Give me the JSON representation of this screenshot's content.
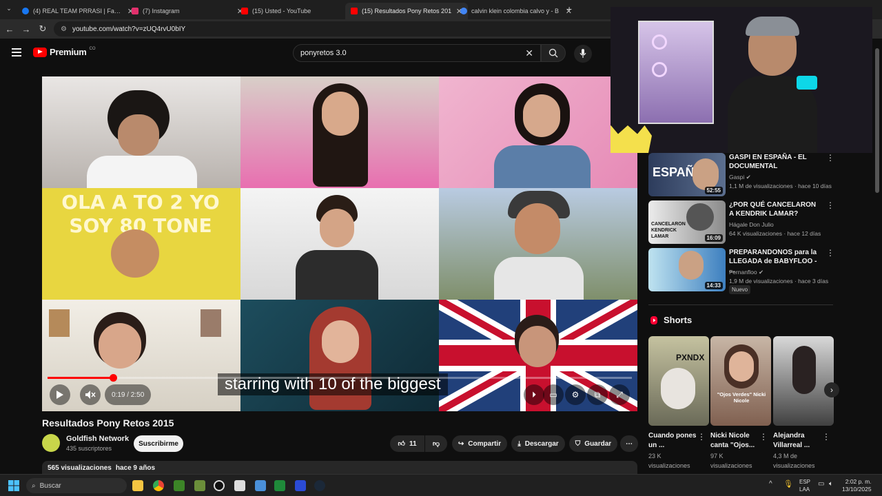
{
  "browser": {
    "tabs": [
      {
        "label": "(4) REAL TEAM PRRASI | Facebo",
        "favicon_color": "#1877f2",
        "favicon": "facebook-icon"
      },
      {
        "label": "(7) Instagram",
        "favicon_color": "#e1306c",
        "favicon": "instagram-icon"
      },
      {
        "label": "(15) Usted - YouTube",
        "favicon_color": "#ff0000",
        "favicon": "youtube-icon"
      },
      {
        "label": "(15) Resultados Pony Retos 201",
        "favicon_color": "#ff0000",
        "favicon": "youtube-icon"
      },
      {
        "label": "calvin klein colombia calvo y - B",
        "favicon_color": "#4285f4",
        "favicon": "google-icon"
      }
    ],
    "active_tab": 3,
    "url": "youtube.com/watch?v=zUQ4rvU0bIY"
  },
  "youtube": {
    "logo_text": "Premium",
    "logo_region": "CO",
    "search_query": "ponyretos 3.0"
  },
  "player": {
    "subtitle": "starring with 10 of the biggest",
    "time": "0:19 / 2:50",
    "progress": 0.112,
    "thumbnail_text": "OLA A TO 2 YO SOY 80 TONE"
  },
  "video": {
    "title": "Resultados Pony Retos 2015",
    "channel": "Goldfish Network",
    "subscribers": "435 suscriptores",
    "subscribe_label": "Suscribirme",
    "likes": "11",
    "share_label": "Compartir",
    "download_label": "Descargar",
    "save_label": "Guardar",
    "views": "565 visualizaciones",
    "age": "hace 9 años"
  },
  "recommendations": [
    {
      "title": "GASPI EN ESPAÑA - EL DOCUMENTAL",
      "channel": "Gaspi",
      "meta": "1,1 M de visualizaciones · hace 10 días",
      "duration": "52:55",
      "thumb_text": "ESPAÑA",
      "color": "#3b4a6b"
    },
    {
      "title": "¿POR QUÉ CANCELARON A KENDRIK LAMAR?",
      "channel": "Hágale Don Julio",
      "meta": "64 K visualizaciones · hace 12 días",
      "duration": "16:09",
      "thumb_text": "CANCELARON KENDRICK LAMAR",
      "color": "#5a5a5a"
    },
    {
      "title": "PREPARANDONOS para la LLEGADA de BABYFLOO - ...",
      "channel": "Fernanfloo",
      "meta": "1,9 M de visualizaciones · hace 3 días",
      "duration": "14:33",
      "badge": "Nuevo",
      "color": "#3d7fbf"
    }
  ],
  "shorts": {
    "header": "Shorts",
    "items": [
      {
        "title": "Cuando pones un ...",
        "views": "23 K",
        "views_suffix": "visualizaciones",
        "color": "#8a8a6a",
        "thumb_text": "PXNDX"
      },
      {
        "title": "Nicki Nicole canta \"Ojos...",
        "views": "97 K",
        "views_suffix": "visualizaciones",
        "color": "#a08070",
        "thumb_text": "\"Ojos Verdes\" Nicki Nicole"
      },
      {
        "title": "Alejandra Villarreal ...",
        "views": "4,3 M de",
        "views_suffix": "visualizaciones",
        "color": "#606060"
      }
    ]
  },
  "taskbar": {
    "search_placeholder": "Buscar",
    "lang": "ESP",
    "lang2": "LAA",
    "time": "2:02 p. m.",
    "date": "13/10/2025"
  }
}
